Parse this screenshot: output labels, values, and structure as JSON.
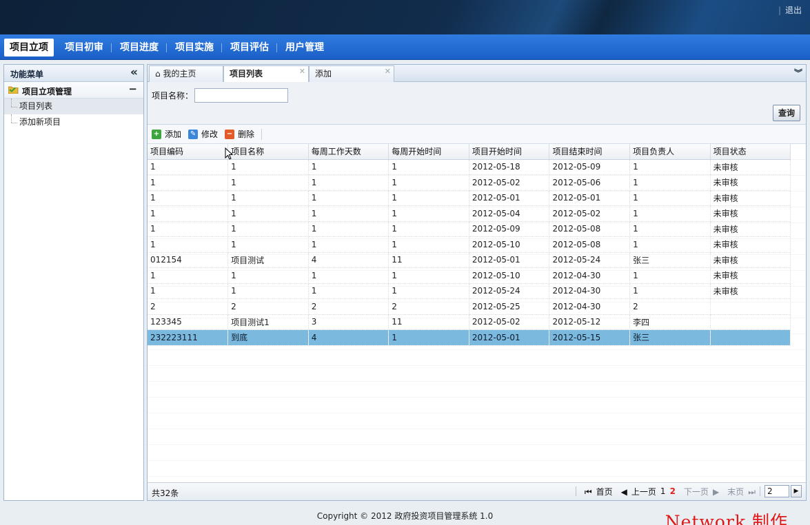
{
  "header": {
    "logout_label": "退出"
  },
  "mainnav": {
    "items": [
      {
        "label": "项目立项"
      },
      {
        "label": "项目初审"
      },
      {
        "label": "项目进度"
      },
      {
        "label": "项目实施"
      },
      {
        "label": "项目评估"
      },
      {
        "label": "用户管理"
      }
    ],
    "active_index": 0
  },
  "sidebar": {
    "title": "功能菜单",
    "group_title": "项目立项管理",
    "items": [
      {
        "label": "项目列表",
        "selected": true
      },
      {
        "label": "添加新项目",
        "selected": false
      }
    ]
  },
  "tabs": [
    {
      "label": "我的主页",
      "closable": false,
      "active": false
    },
    {
      "label": "项目列表",
      "closable": true,
      "active": true
    },
    {
      "label": "添加",
      "closable": true,
      "active": false
    }
  ],
  "search": {
    "name_label": "项目名称：",
    "name_value": "",
    "query_label": "查询"
  },
  "toolbar": {
    "add_label": "添加",
    "edit_label": "修改",
    "delete_label": "删除"
  },
  "table": {
    "columns": [
      "项目编码",
      "项目名称",
      "每周工作天数",
      "每周开始时间",
      "项目开始时间",
      "项目结束时间",
      "项目负责人",
      "项目状态"
    ],
    "rows": [
      [
        "1",
        "1",
        "1",
        "1",
        "2012-05-18",
        "2012-05-09",
        "1",
        "未审核"
      ],
      [
        "1",
        "1",
        "1",
        "1",
        "2012-05-02",
        "2012-05-06",
        "1",
        "未审核"
      ],
      [
        "1",
        "1",
        "1",
        "1",
        "2012-05-01",
        "2012-05-01",
        "1",
        "未审核"
      ],
      [
        "1",
        "1",
        "1",
        "1",
        "2012-05-04",
        "2012-05-02",
        "1",
        "未审核"
      ],
      [
        "1",
        "1",
        "1",
        "1",
        "2012-05-09",
        "2012-05-08",
        "1",
        "未审核"
      ],
      [
        "1",
        "1",
        "1",
        "1",
        "2012-05-10",
        "2012-05-08",
        "1",
        "未审核"
      ],
      [
        "012154",
        "项目测试",
        "4",
        "11",
        "2012-05-01",
        "2012-05-24",
        "张三",
        "未审核"
      ],
      [
        "1",
        "1",
        "1",
        "1",
        "2012-05-10",
        "2012-04-30",
        "1",
        "未审核"
      ],
      [
        "1",
        "1",
        "1",
        "1",
        "2012-05-24",
        "2012-04-30",
        "1",
        "未审核"
      ],
      [
        "2",
        "2",
        "2",
        "2",
        "2012-05-25",
        "2012-04-30",
        "2",
        ""
      ],
      [
        "123345",
        "项目测试1",
        "3",
        "11",
        "2012-05-02",
        "2012-05-12",
        "李四",
        ""
      ],
      [
        "232223111",
        "到底",
        "4",
        "1",
        "2012-05-01",
        "2012-05-15",
        "张三",
        ""
      ]
    ],
    "selected_row": 11
  },
  "pager": {
    "total": "共32条",
    "first": "首页",
    "prev": "上一页",
    "pages": [
      "1",
      "2"
    ],
    "current_page": "2",
    "next": "下一页",
    "last": "末页",
    "page_input": "2"
  },
  "footer": {
    "copyright": "Copyright © 2012 政府投资项目管理系统 1.0",
    "watermark": "Network 制作"
  },
  "colors": {
    "nav_blue": "#1f66d0",
    "selected_row": "#7cb9de",
    "current_page": "#e02020",
    "watermark": "#e01818"
  }
}
